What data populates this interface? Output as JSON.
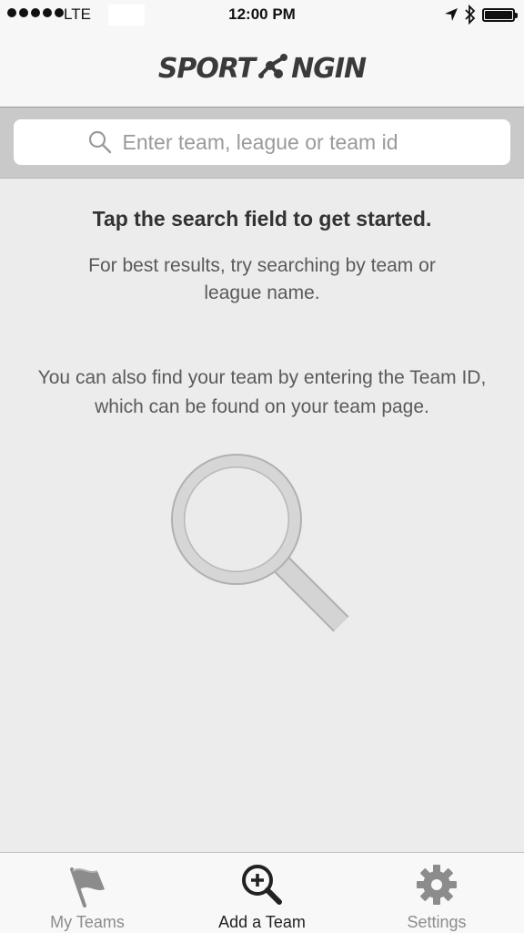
{
  "status_bar": {
    "carrier": "LTE",
    "time": "12:00 PM"
  },
  "header": {
    "logo_left": "SPORT",
    "logo_right": "NGIN"
  },
  "search": {
    "placeholder": "Enter team, league or team id"
  },
  "content": {
    "headline": "Tap the search field to get started.",
    "subtext": "For best results, try searching by team or league name.",
    "team_id_text": "You can also find your team by entering the Team ID, which can be found on your team page."
  },
  "tabs": [
    {
      "label": "My Teams",
      "icon": "flag-icon",
      "active": false
    },
    {
      "label": "Add a Team",
      "icon": "add-search-icon",
      "active": true
    },
    {
      "label": "Settings",
      "icon": "gear-icon",
      "active": false
    }
  ],
  "colors": {
    "background": "#ececec",
    "search_strip": "#c9c9c9",
    "tab_active": "#222222",
    "tab_inactive": "#8c8c8c"
  }
}
